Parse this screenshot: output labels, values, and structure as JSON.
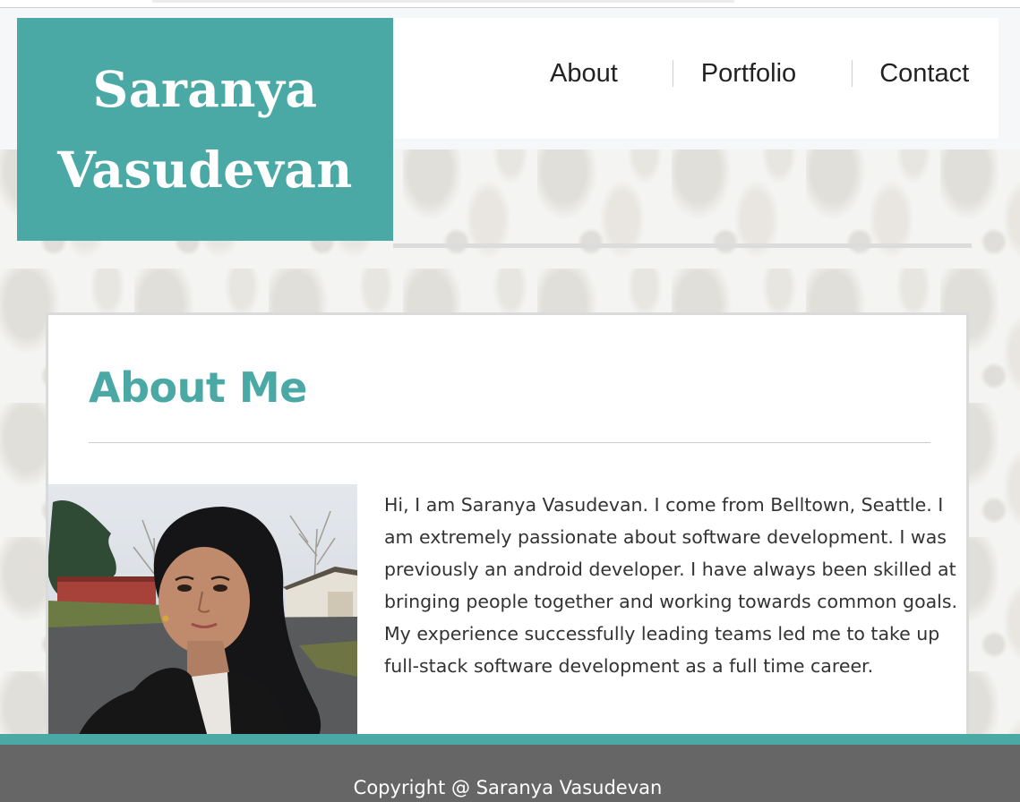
{
  "site": {
    "name_line1": "Saranya",
    "name_line2": "Vasudevan"
  },
  "nav": {
    "items": [
      {
        "label": "About"
      },
      {
        "label": "Portfolio"
      },
      {
        "label": "Contact"
      }
    ]
  },
  "about": {
    "title": "About Me",
    "bio": "Hi, I am Saranya Vasudevan. I come from Belltown, Seattle. I am extremely passionate about software development. I was previously an android developer. I have always been skilled at bringing people together and working towards common goals. My experience successfully leading teams led me to take up full-stack software development as a full time career."
  },
  "footer": {
    "copyright": "Copyright @ Saranya Vasudevan"
  },
  "colors": {
    "accent": "#4aa8a5",
    "footer_bg": "#666666",
    "text": "#333333"
  }
}
